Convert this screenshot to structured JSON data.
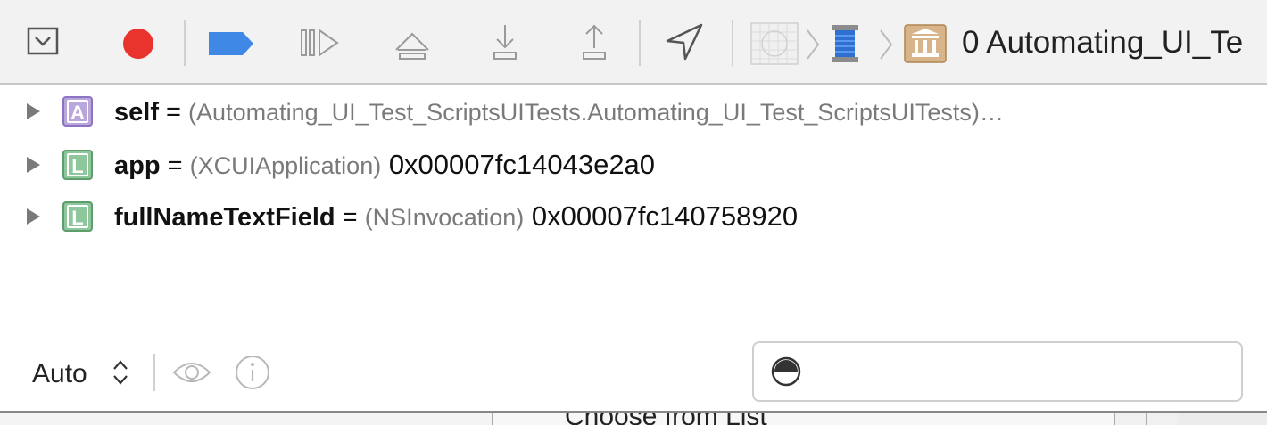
{
  "toolbar": {
    "buttons": [
      {
        "name": "hide-debug-area-button",
        "icon": "tray-down-icon"
      },
      {
        "name": "breakpoint-button",
        "icon": "record-dot-icon",
        "color": "#e8342c"
      },
      {
        "name": "toggle-breakpoints-button",
        "icon": "breakpoint-tag-icon",
        "color": "#3f88e6"
      },
      {
        "name": "continue-button",
        "icon": "pause-continue-icon"
      },
      {
        "name": "step-over-button",
        "icon": "step-over-icon"
      },
      {
        "name": "step-into-button",
        "icon": "step-into-icon"
      },
      {
        "name": "step-out-button",
        "icon": "step-out-icon"
      },
      {
        "name": "simulate-location-button",
        "icon": "location-arrow-icon"
      }
    ],
    "breadcrumb": {
      "items": [
        "app-icon",
        "thread-spool-icon",
        "stack-frame-icon"
      ],
      "label": "0 Automating_UI_Te"
    }
  },
  "variables": [
    {
      "kind": "A",
      "kind_color": "#b9a7dc",
      "name": "self",
      "eq": " = ",
      "type": "(Automating_UI_Test_ScriptsUITests.Automating_UI_Test_ScriptsUITests)…",
      "value": ""
    },
    {
      "kind": "L",
      "kind_color": "#8fc79c",
      "name": "app",
      "eq": " = ",
      "type": "(XCUIApplication)",
      "value": " 0x00007fc14043e2a0"
    },
    {
      "kind": "L",
      "kind_color": "#8fc79c",
      "name": "fullNameTextField",
      "eq": " = ",
      "type": "(NSInvocation)",
      "value": " 0x00007fc140758920"
    }
  ],
  "bottombar": {
    "scope_label": "Auto",
    "scope_arrows": "⌃⌄",
    "filter_placeholder": ""
  },
  "lower_pane": {
    "visible_text": "Choose from List"
  }
}
